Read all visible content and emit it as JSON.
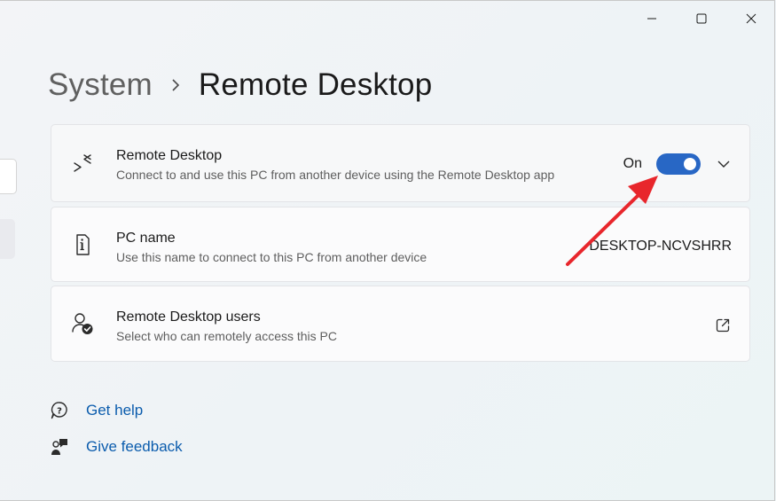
{
  "window": {
    "controls": {
      "minimize_icon": "minimize-icon",
      "maximize_icon": "maximize-icon",
      "close_icon": "close-icon"
    }
  },
  "breadcrumb": {
    "parent": "System",
    "separator_icon": "chevron-right-icon",
    "current": "Remote Desktop"
  },
  "cards": {
    "remote_desktop": {
      "icon": "remote-desktop-icon",
      "title": "Remote Desktop",
      "description": "Connect to and use this PC from another device using the Remote Desktop app",
      "toggle_label": "On",
      "toggle_on": true,
      "expand_icon": "chevron-down-icon"
    },
    "pc_name": {
      "icon": "pc-info-icon",
      "title": "PC name",
      "description": "Use this name to connect to this PC from another device",
      "value": "DESKTOP-NCVSHRR"
    },
    "users": {
      "icon": "users-check-icon",
      "title": "Remote Desktop users",
      "description": "Select who can remotely access this PC",
      "link_icon": "open-external-icon"
    }
  },
  "help": {
    "get_help": "Get help",
    "give_feedback": "Give feedback"
  },
  "colors": {
    "accent": "#2867c5",
    "link": "#0b5cad",
    "annotation": "#e8262c"
  }
}
